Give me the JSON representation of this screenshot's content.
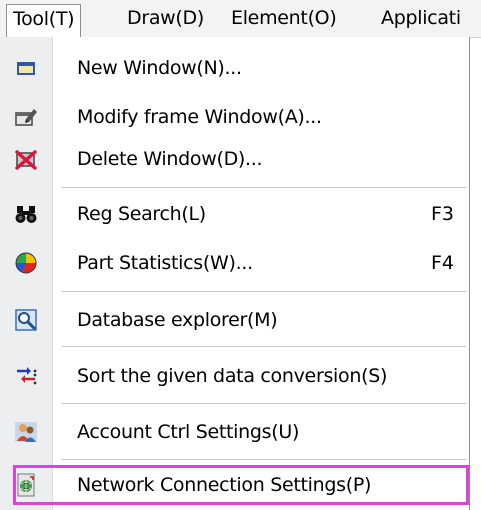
{
  "menubar": {
    "items": [
      {
        "label": "Tool(T)",
        "name": "menu-tool"
      },
      {
        "label": "Draw(D)",
        "name": "menu-draw"
      },
      {
        "label": "Element(O)",
        "name": "menu-element"
      },
      {
        "label": "Applicati",
        "name": "menu-application"
      }
    ]
  },
  "menu": {
    "items": [
      {
        "label": "New Window(N)...",
        "shortcut": "",
        "icon": "window-icon"
      },
      {
        "label": "Modify frame Window(A)...",
        "shortcut": "",
        "icon": "edit-window-icon"
      },
      {
        "label": "Delete Window(D)...",
        "shortcut": "",
        "icon": "delete-icon"
      },
      {
        "label": "Reg Search(L)",
        "shortcut": "F3",
        "icon": "binoculars-icon"
      },
      {
        "label": "Part Statistics(W)...",
        "shortcut": "F4",
        "icon": "pie-chart-icon"
      },
      {
        "label": "Database explorer(M)",
        "shortcut": "",
        "icon": "magnifier-icon"
      },
      {
        "label": "Sort the given data conversion(S)",
        "shortcut": "",
        "icon": "sort-icon"
      },
      {
        "label": "Account Ctrl Settings(U)",
        "shortcut": "",
        "icon": "users-icon"
      },
      {
        "label": "Network Connection Settings(P)",
        "shortcut": "",
        "icon": "network-icon"
      }
    ]
  },
  "colors": {
    "highlight": "#e040e0"
  }
}
